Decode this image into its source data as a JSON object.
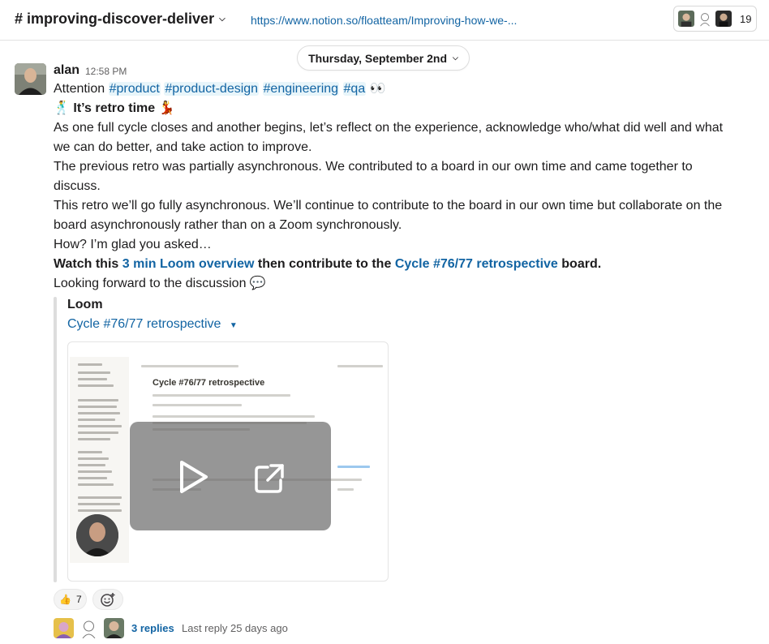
{
  "header": {
    "channel": "# improving-discover-deliver",
    "link": "https://www.notion.so/floatteam/Improving-how-we-...",
    "member_count": "19"
  },
  "date_divider": "Thursday, September 2nd",
  "message": {
    "sender": "alan",
    "time": "12:58 PM",
    "attention": "Attention",
    "tags": [
      "#product",
      "#product-design",
      "#engineering",
      "#qa"
    ],
    "retro": "It’s retro time",
    "p1a": "As one full cycle closes and another begins, let’s reflect on the experience, acknowledge who/what did well and what",
    "p1b": "we can do better, and take action to improve.",
    "p2a": "The previous retro was partially asynchronous. We contributed to a board in our own time and came together to",
    "p2b": "discuss.",
    "p3a": "This retro we’ll go fully asynchronous. We’ll continue to contribute to the board in our own time but collaborate on the",
    "p3b": "board asynchronously rather than on a Zoom synchronously.",
    "p4": "How? I’m glad you asked…",
    "watch_prefix": "Watch this",
    "loom_link": "3 min Loom overview",
    "watch_mid": "then contribute to the",
    "retro_link": "Cycle #76/77 retrospective",
    "watch_suffix": "board.",
    "closing": "Looking forward to the discussion"
  },
  "attachment": {
    "source": "Loom",
    "title": "Cycle #76/77 retrospective",
    "preview_heading": "Cycle #76/77 retrospective"
  },
  "reactions": [
    {
      "icon": "thumbs-up-icon",
      "glyph": "👍",
      "count": "7"
    }
  ],
  "thread": {
    "replies": "3 replies",
    "last_reply": "Last reply 25 days ago"
  }
}
